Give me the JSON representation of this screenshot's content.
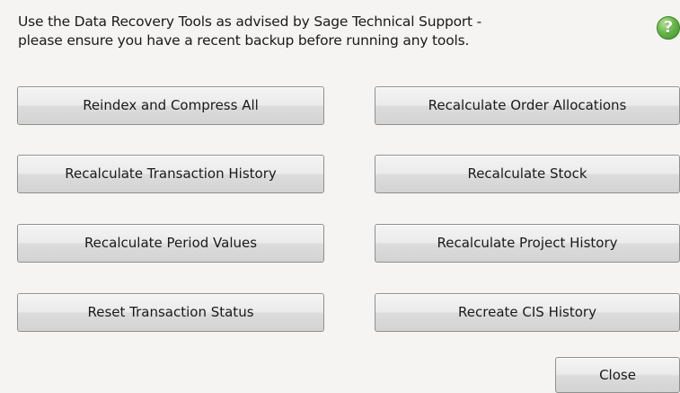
{
  "instructions": {
    "line1": "Use the Data Recovery Tools as advised by Sage Technical Support -",
    "line2": "please ensure you have a recent backup before running any tools."
  },
  "help": {
    "icon": "help-icon",
    "glyph": "?",
    "color": "#5aab3f"
  },
  "tools": {
    "reindex_compress_all": "Reindex and Compress All",
    "recalculate_order_allocations": "Recalculate Order Allocations",
    "recalculate_transaction_history": "Recalculate Transaction History",
    "recalculate_stock": "Recalculate Stock",
    "recalculate_period_values": "Recalculate Period Values",
    "recalculate_project_history": "Recalculate Project History",
    "reset_transaction_status": "Reset Transaction Status",
    "recreate_cis_history": "Recreate CIS History"
  },
  "footer": {
    "close_label": "Close"
  }
}
